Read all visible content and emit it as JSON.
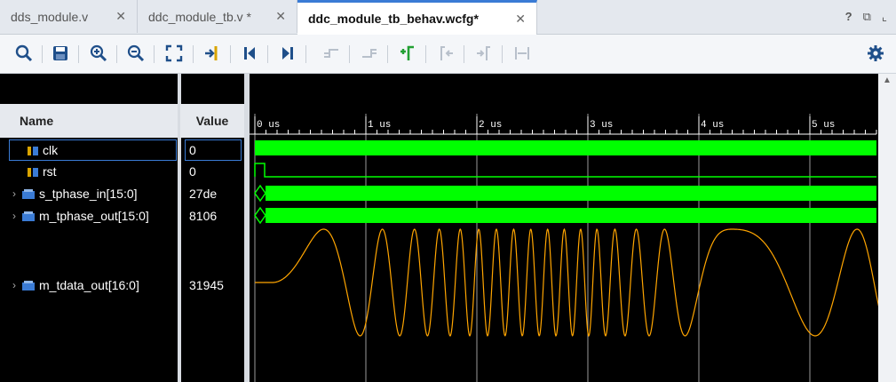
{
  "tabs": [
    {
      "label": "dds_module.v",
      "active": false
    },
    {
      "label": "ddc_module_tb.v *",
      "active": false
    },
    {
      "label": "ddc_module_tb_behav.wcfg*",
      "active": true
    }
  ],
  "window_buttons": {
    "help": "?",
    "restore": "⧉",
    "maximize": "⌞"
  },
  "toolbar": {
    "icons": [
      "search-icon",
      "save-icon",
      "zoom-in-icon",
      "zoom-out-icon",
      "zoom-fit-icon",
      "go-to-cursor-icon",
      "go-to-time-zero-icon",
      "go-to-last-time-icon",
      "previous-transition-icon",
      "next-transition-icon",
      "add-marker-icon",
      "previous-marker-icon",
      "next-marker-icon",
      "swap-cursors-icon",
      "settings-icon"
    ]
  },
  "headers": {
    "name": "Name",
    "value": "Value"
  },
  "signals": [
    {
      "name": "clk",
      "value": "0",
      "type": "bit"
    },
    {
      "name": "rst",
      "value": "0",
      "type": "bit"
    },
    {
      "name": "s_tphase_in[15:0]",
      "value": "27de",
      "type": "bus"
    },
    {
      "name": "m_tphase_out[15:0]",
      "value": "8106",
      "type": "bus"
    },
    {
      "name": "m_tdata_out[16:0]",
      "value": "31945",
      "type": "analog"
    }
  ],
  "timeline": {
    "ticks": [
      "0 us",
      "1 us",
      "2 us",
      "3 us",
      "4 us",
      "5 us"
    ]
  },
  "colors": {
    "signal": "#00ff00",
    "analog": "#ffa500",
    "background": "#000000",
    "grid": "#9a9a9a",
    "selection": "#3a7bd5"
  }
}
